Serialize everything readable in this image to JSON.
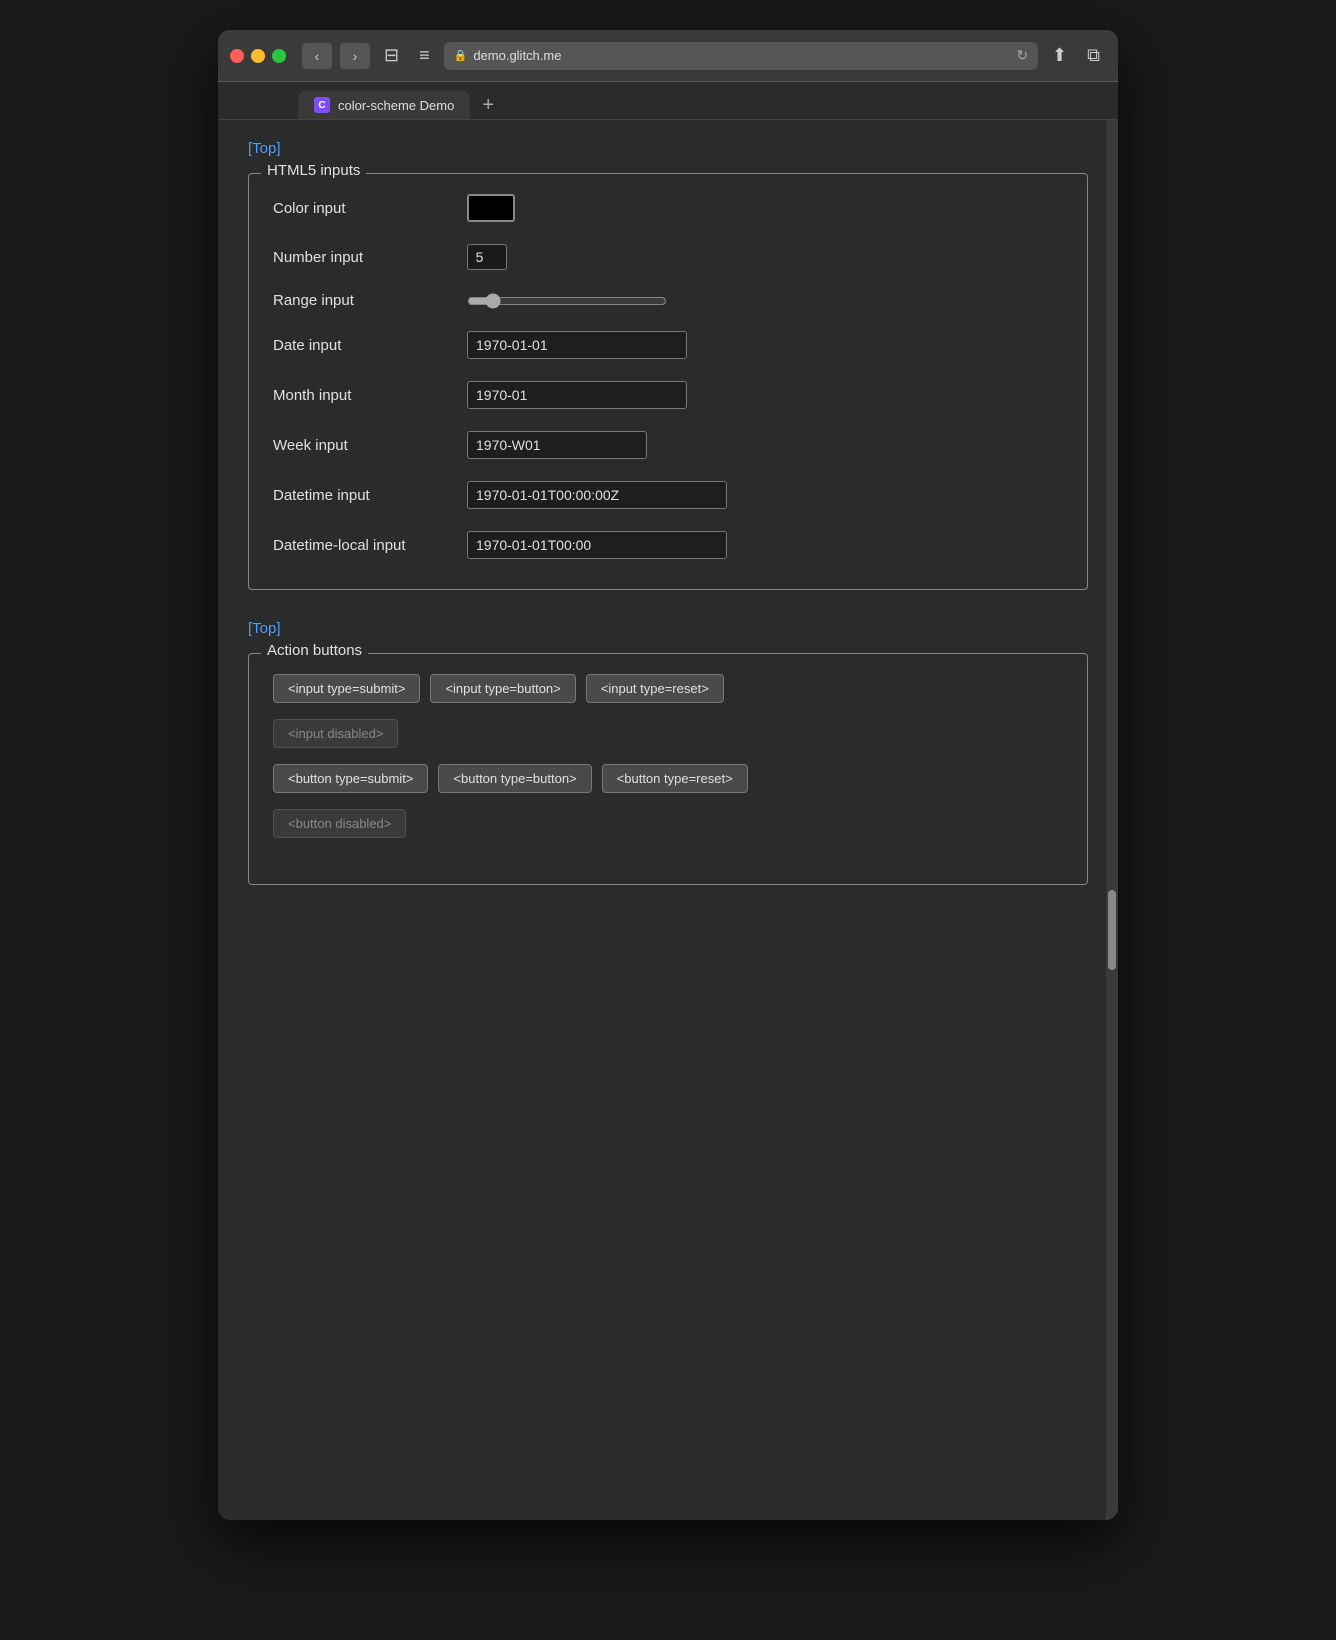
{
  "browser": {
    "url": "demo.glitch.me",
    "tab_title": "color-scheme Demo",
    "tab_favicon_letter": "C"
  },
  "nav": {
    "back": "‹",
    "forward": "›",
    "sidebar": "⊟",
    "menu": "≡",
    "reload": "↻",
    "share": "⬆",
    "new_window": "⧉",
    "plus": "+"
  },
  "page": {
    "top_link_1": "[Top]",
    "top_link_2": "[Top]",
    "html5_section_legend": "HTML5 inputs",
    "action_section_legend": "Action buttons",
    "color_label": "Color input",
    "number_label": "Number input",
    "number_value": "5",
    "range_label": "Range input",
    "date_label": "Date input",
    "date_value": "1970-01-01",
    "month_label": "Month input",
    "month_value": "1970-01",
    "week_label": "Week input",
    "week_value": "1970-W01",
    "datetime_label": "Datetime input",
    "datetime_value": "1970-01-01T00:00:00Z",
    "datetime_local_label": "Datetime-local input",
    "datetime_local_value": "1970-01-01T00:00",
    "btn_input_submit": "<input type=submit>",
    "btn_input_button": "<input type=button>",
    "btn_input_reset": "<input type=reset>",
    "btn_input_disabled": "<input disabled>",
    "btn_button_submit": "<button type=submit>",
    "btn_button_button": "<button type=button>",
    "btn_button_reset": "<button type=reset>",
    "btn_button_disabled": "<button disabled>"
  }
}
